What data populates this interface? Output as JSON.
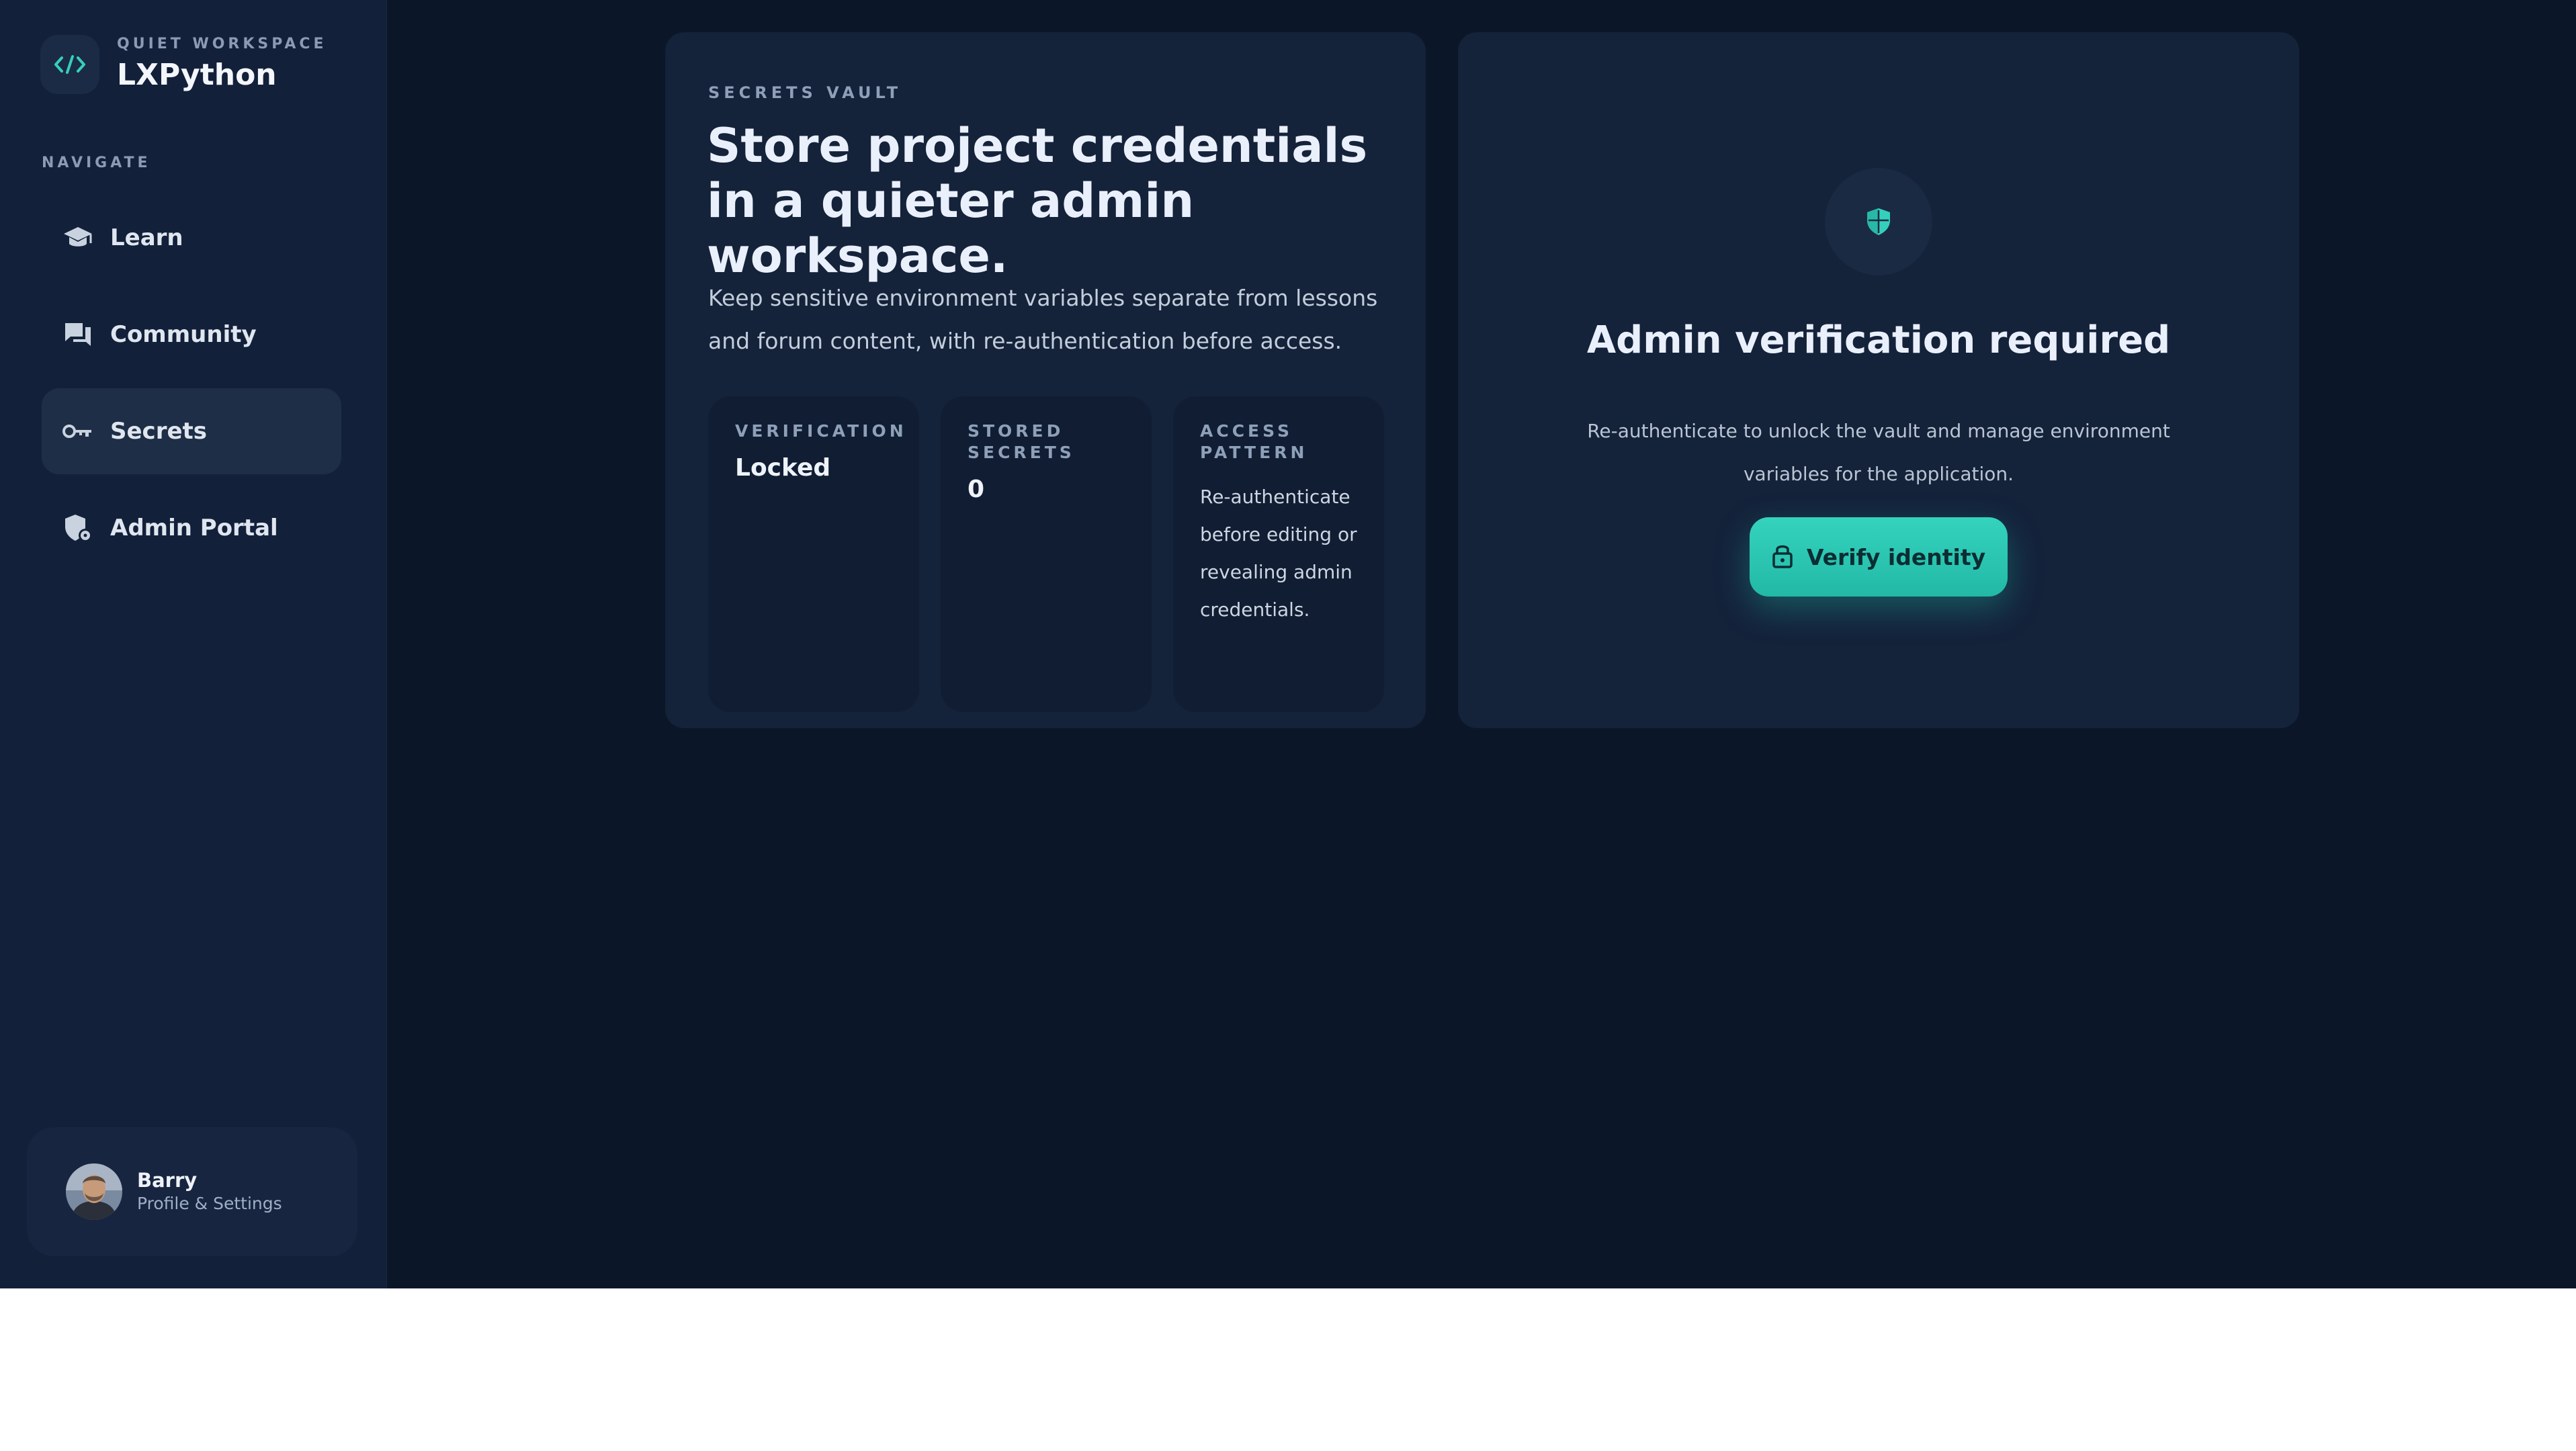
{
  "brand": {
    "eyebrow": "QUIET WORKSPACE",
    "name": "LXPython",
    "icon": "code-icon"
  },
  "sidebar": {
    "heading": "NAVIGATE",
    "items": [
      {
        "label": "Learn",
        "icon": "graduation-cap-icon",
        "active": false
      },
      {
        "label": "Community",
        "icon": "chat-icon",
        "active": false
      },
      {
        "label": "Secrets",
        "icon": "key-icon",
        "active": true
      },
      {
        "label": "Admin Portal",
        "icon": "admin-shield-icon",
        "active": false
      }
    ]
  },
  "user": {
    "name": "Barry",
    "subtitle": "Profile & Settings"
  },
  "vault": {
    "eyebrow": "SECRETS VAULT",
    "title": "Store project credentials in a quieter admin workspace.",
    "description": "Keep sensitive environment variables separate from lessons and forum content, with re-authentication before access.",
    "stats": [
      {
        "label": "VERIFICATION",
        "value": "Locked"
      },
      {
        "label": "STORED SECRETS",
        "value": "0"
      },
      {
        "label": "ACCESS PATTERN",
        "value": "Re-authenticate before editing or revealing admin credentials."
      }
    ]
  },
  "verify": {
    "icon": "shield-icon",
    "title": "Admin verification required",
    "description": "Re-authenticate to unlock the vault and manage environment variables for the application.",
    "button_label": "Verify identity",
    "button_icon": "lock-icon"
  },
  "colors": {
    "background": "#0b1628",
    "sidebar": "#13203a",
    "card": "#14223a",
    "accent": "#2dc9b3",
    "text": "#eaf0fb"
  }
}
